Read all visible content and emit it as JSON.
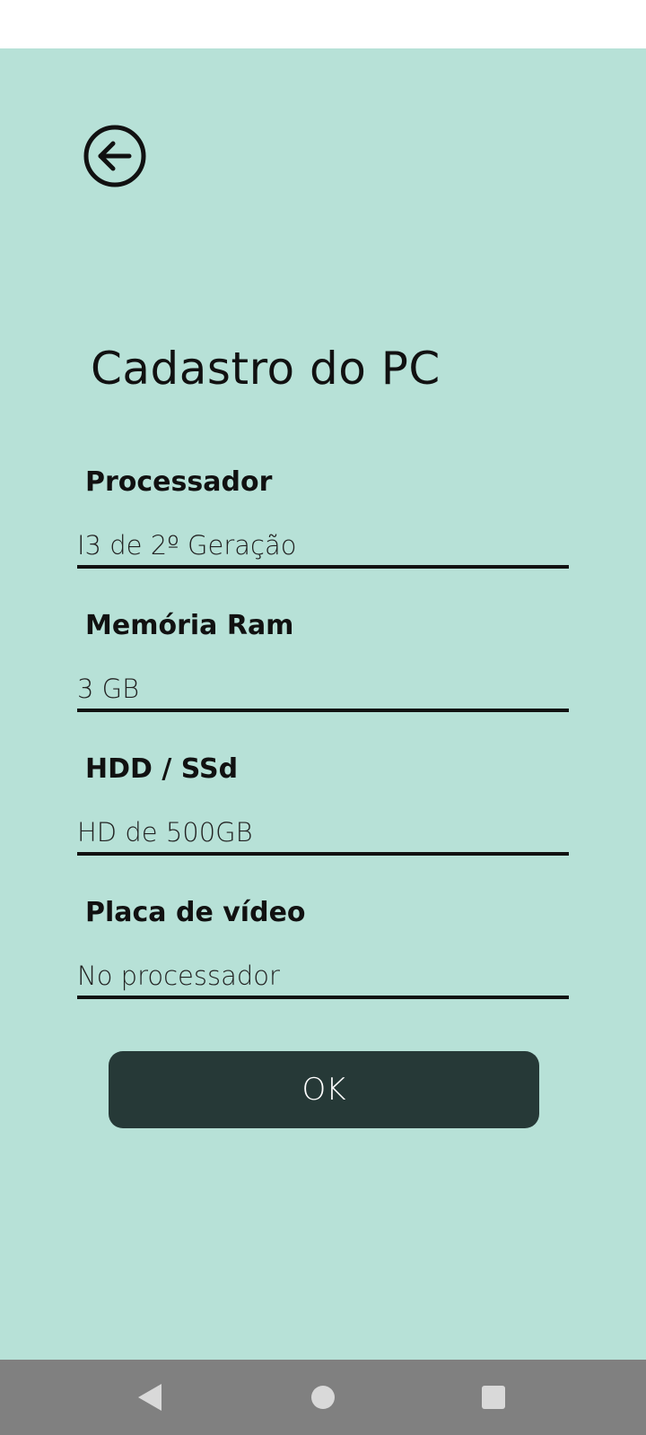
{
  "header": {
    "back_icon": "arrow-left-circle-icon"
  },
  "page": {
    "title": "Cadastro do PC"
  },
  "form": {
    "fields": [
      {
        "label": "Processador",
        "value": "I3 de 2º Geração"
      },
      {
        "label": "Memória Ram",
        "value": "3 GB"
      },
      {
        "label": "HDD / SSd",
        "value": "HD de 500GB"
      },
      {
        "label": "Placa de vídeo",
        "value": "No processador"
      }
    ],
    "submit_label": "OK"
  },
  "navbar": {
    "back_icon": "nav-back-triangle-icon",
    "home_icon": "nav-home-circle-icon",
    "recent_icon": "nav-recents-square-icon"
  },
  "colors": {
    "background": "#b7e1d7",
    "button": "#263937",
    "navbar": "#808080"
  }
}
